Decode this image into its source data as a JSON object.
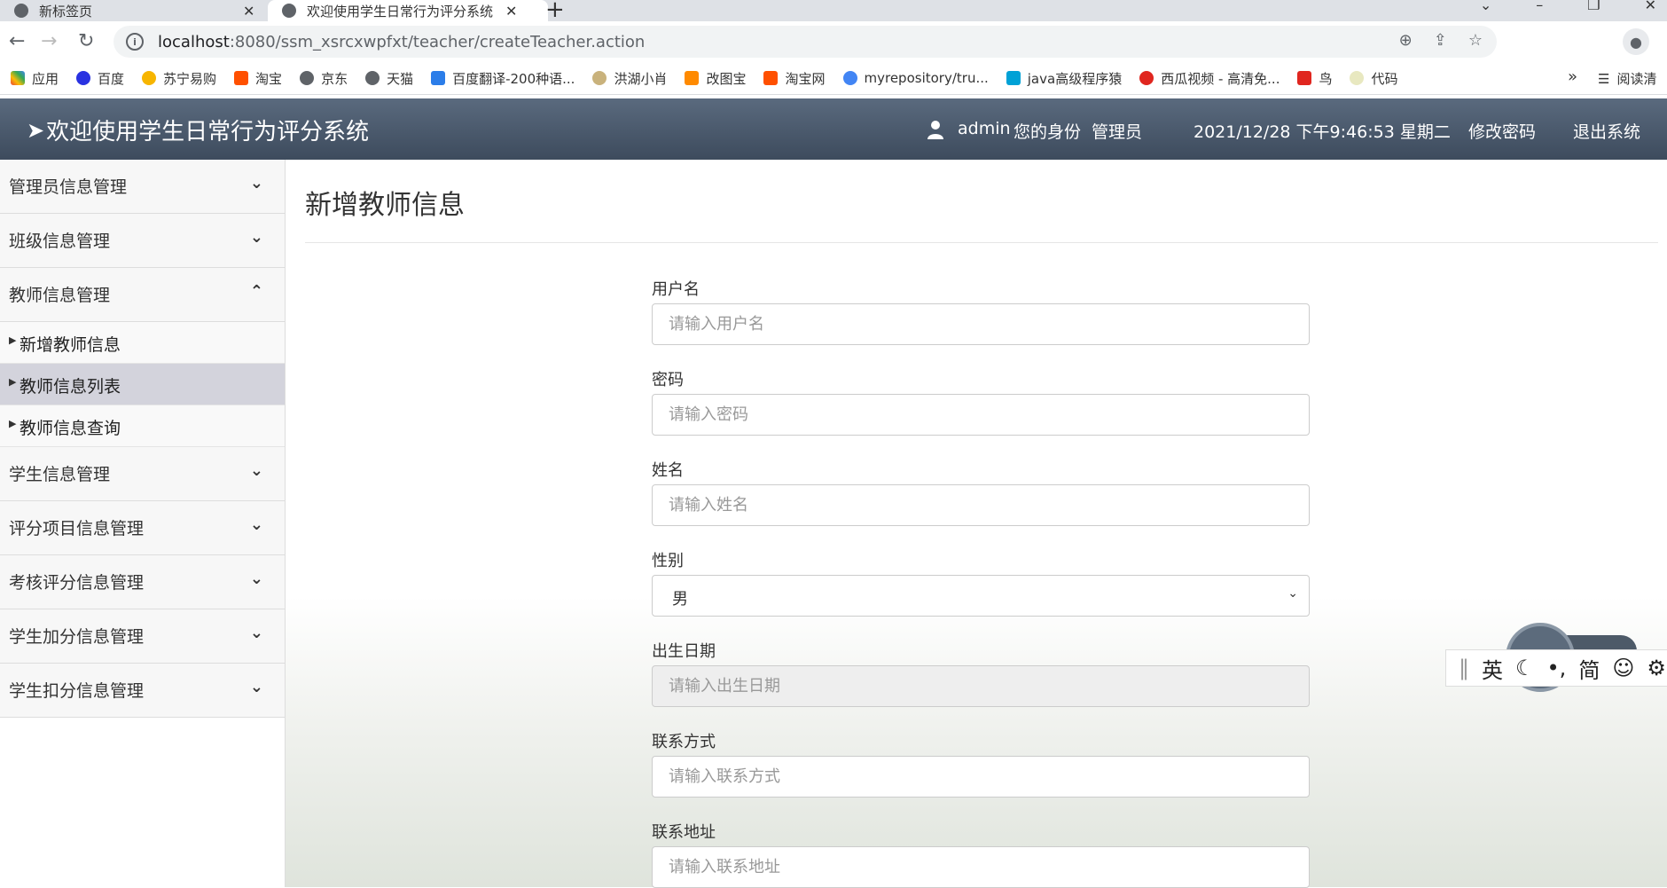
{
  "browser": {
    "tabs": [
      {
        "title": "新标签页",
        "active": false
      },
      {
        "title": "欢迎使用学生日常行为评分系统",
        "active": true
      }
    ],
    "url_host": "localhost",
    "url_path": ":8080/ssm_xsrcxwpfxt/teacher/createTeacher.action",
    "bookmarks": [
      "应用",
      "百度",
      "苏宁易购",
      "淘宝",
      "京东",
      "天猫",
      "百度翻译-200种语...",
      "洪湖小肖",
      "改图宝",
      "淘宝网",
      "myrepository/tru...",
      "java高级程序猿",
      "西瓜视频 - 高清免...",
      "鸟",
      "代码"
    ],
    "bookmarks_more": "»",
    "reading_list": "阅读清"
  },
  "header": {
    "title": "欢迎使用学生日常行为评分系统",
    "username": "admin",
    "identity_label": "您的身份",
    "identity": "管理员",
    "datetime": "2021/12/28 下午9:46:53 星期二",
    "change_password": "修改密码",
    "logout": "退出系统"
  },
  "sidebar": {
    "groups": [
      {
        "label": "管理员信息管理",
        "expanded": false
      },
      {
        "label": "班级信息管理",
        "expanded": false
      },
      {
        "label": "教师信息管理",
        "expanded": true,
        "items": [
          "新增教师信息",
          "教师信息列表",
          "教师信息查询"
        ],
        "active_item": "教师信息列表"
      },
      {
        "label": "学生信息管理",
        "expanded": false
      },
      {
        "label": "评分项目信息管理",
        "expanded": false
      },
      {
        "label": "考核评分信息管理",
        "expanded": false
      },
      {
        "label": "学生加分信息管理",
        "expanded": false
      },
      {
        "label": "学生扣分信息管理",
        "expanded": false
      }
    ]
  },
  "form": {
    "title": "新增教师信息",
    "fields": [
      {
        "label": "用户名",
        "placeholder": "请输入用户名",
        "value": ""
      },
      {
        "label": "密码",
        "placeholder": "请输入密码",
        "value": ""
      },
      {
        "label": "姓名",
        "placeholder": "请输入姓名",
        "value": ""
      },
      {
        "label": "性别",
        "type": "select",
        "value": "男"
      },
      {
        "label": "出生日期",
        "placeholder": "请输入出生日期",
        "value": "",
        "disabled": true
      },
      {
        "label": "联系方式",
        "placeholder": "请输入联系方式",
        "value": ""
      },
      {
        "label": "联系地址",
        "placeholder": "请输入联系地址",
        "value": ""
      }
    ]
  },
  "ime": {
    "items": [
      "英",
      "简"
    ]
  },
  "colors": {
    "header_bg": "#4a5a6e",
    "active_menu": "#d3d3dc"
  }
}
